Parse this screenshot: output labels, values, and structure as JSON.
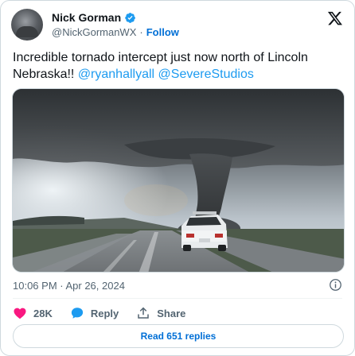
{
  "author": {
    "name": "Nick Gorman",
    "handle": "@NickGormanWX",
    "separator": "·",
    "follow_label": "Follow"
  },
  "tweet": {
    "text_prefix": "Incredible tornado intercept just now north of Lincoln Nebraska!! ",
    "mention_1": "@ryanhallyall",
    "mention_2": "@SevereStudios",
    "timestamp": "10:06 PM · Apr 26, 2024"
  },
  "actions": {
    "likes": "28K",
    "reply_label": "Reply",
    "share_label": "Share"
  },
  "replies_button": "Read 651 replies",
  "colors": {
    "accent": "#1d9bf0",
    "link": "#006fd6",
    "like": "#f91880",
    "muted": "#536471"
  }
}
